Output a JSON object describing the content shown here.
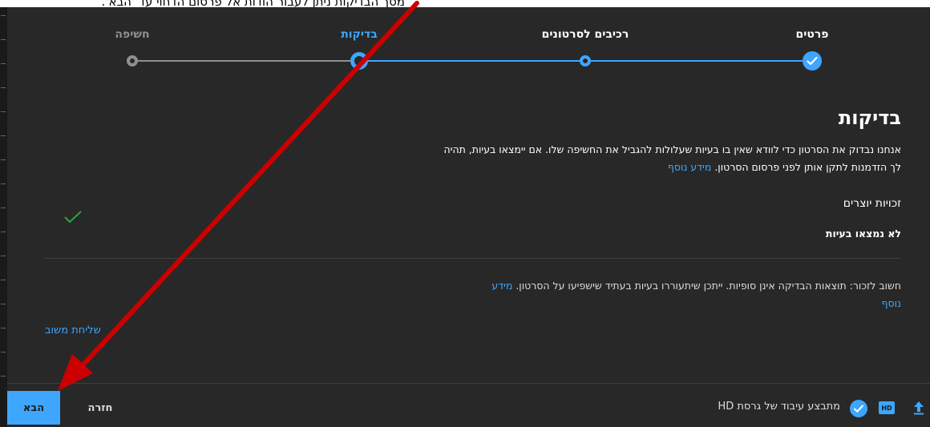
{
  "caption": "מסך הבדיקות ניתן לעבור הודות אל פרסום הדחוי עד 'הבא'.",
  "stepper": {
    "steps": [
      {
        "label": "פרטים",
        "state": "done"
      },
      {
        "label": "רכיבים לסרטונים",
        "state": "done"
      },
      {
        "label": "בדיקות",
        "state": "current"
      },
      {
        "label": "חשיפה",
        "state": "upcoming"
      }
    ]
  },
  "checks": {
    "title": "בדיקות",
    "description_line1": "אנחנו נבדוק את הסרטון כדי לוודא שאין בו בעיות שעלולות להגביל את החשיפה שלו. אם יימצאו בעיות, תהיה",
    "description_line2": "לך הזדמנות לתקן אותן לפני פרסום הסרטון.",
    "learn_more": "מידע נוסף",
    "copyright_title": "זכויות יוצרים",
    "copyright_status": "לא נמצאו בעיות",
    "note": "חשוב לזכור: תוצאות הבדיקה אינן סופיות. ייתכן שיתעוררו בעיות בעתיד שישפיעו על הסרטון.",
    "note_link_part1": "מידע",
    "note_link_part2": "נוסף",
    "feedback": "שליחת משוב"
  },
  "footer": {
    "status": "מתבצע עיבוד של גרסת HD",
    "hd_badge": "HD",
    "back_label": "חזרה",
    "next_label": "הבא"
  },
  "colors": {
    "background": "#282828",
    "accent": "#3ea6ff",
    "check_green": "#2ba640",
    "inactive": "#909090",
    "annotation_arrow": "#cc0000"
  }
}
